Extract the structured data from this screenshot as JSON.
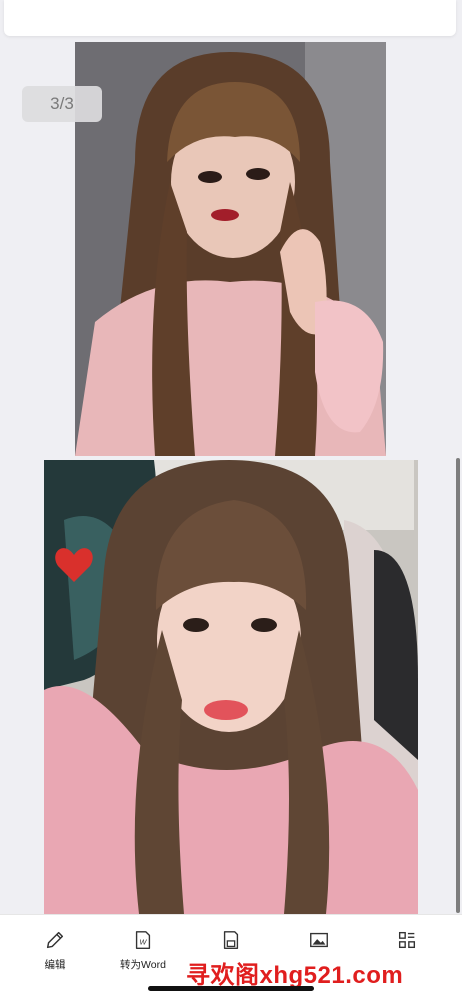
{
  "viewer": {
    "page_indicator": "3/3"
  },
  "images": [
    {
      "name": "portrait-photo-1"
    },
    {
      "name": "portrait-photo-2"
    }
  ],
  "toolbar": {
    "items": [
      {
        "label": "编辑",
        "icon": "pencil-icon"
      },
      {
        "label": "转为Word",
        "icon": "word-document-icon"
      },
      {
        "label": "",
        "icon": "save-icon"
      },
      {
        "label": "",
        "icon": "image-icon"
      },
      {
        "label": "",
        "icon": "grid-icon"
      }
    ]
  },
  "watermark": {
    "text": "寻欢阁xhg521.com",
    "color": "#e01e1e"
  }
}
